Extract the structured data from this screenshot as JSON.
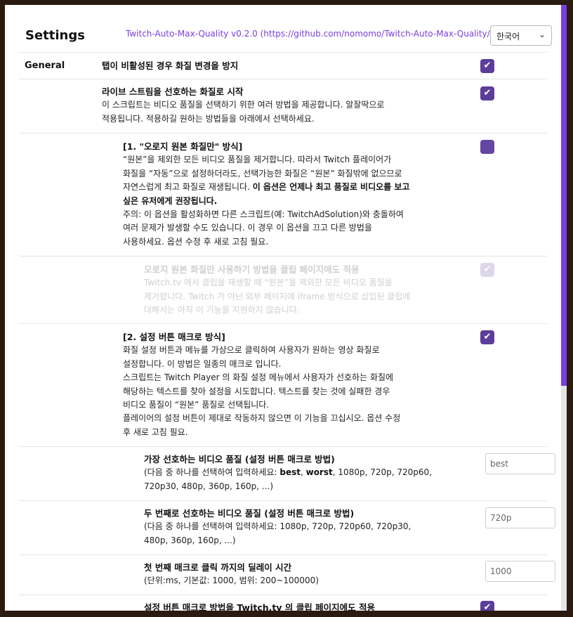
{
  "header": {
    "title": "Settings",
    "repo_link": "Twitch-Auto-Max-Quality v0.2.0 (https://github.com/nomomo/Twitch-Auto-Max-Quality/)",
    "language": "한국어"
  },
  "section_label": "General",
  "rows": {
    "r1": {
      "title": "탭이 비활성된 경우 화질 변경을 방지",
      "checked": true
    },
    "r2": {
      "title": "라이브 스트림을 선호하는 화질로 시작",
      "desc1": "이 스크립트는 비디오 품질을 선택하기 위한 여러 방법을 제공합니다. 알잘딱으로",
      "desc2": "적용됩니다. 적용하길 원하는 방법들을 아래에서 선택하세요.",
      "checked": true
    },
    "r3": {
      "title": "[1. \"오로지 원본 화질만\" 방식]",
      "l1": "“원본”을 제외한 모든 비디오 품질을 제거합니다. 따라서 Twitch 플레이어가",
      "l2": "화질을 “자동”으로 설정하더라도, 선택가능한 화질은 “원본” 화질밖에 없으므로",
      "l3a": "자연스럽게 최고 화질로 재생됩니다. ",
      "l3b": "이 옵션은 언제나 최고 품질로 비디오를 보고",
      "l4": "싶은 유저에게 권장됩니다.",
      "l5": "주의: 이 옵션을 활성화하면 다른 스크립트(예: TwitchAdSolution)와 충돌하여",
      "l6": "여러 문제가 발생할 수도 있습니다. 이 경우 이 옵션을 끄고 다른 방법을",
      "l7": "사용하세요. 옵션 수정 후 새로 고침 필요.",
      "checked": true
    },
    "r4": {
      "title": "오로지 원본 화질만 사용하기 방법을 클립 페이지에도 적용",
      "l1": "Twitch.tv 에서 클립을 재생할 때 “원본”을 제외한 모든 비디오 품질을",
      "l2": "제거합니다. Twitch 가 아닌 외부 페이지에 iframe 방식으로 삽입된 클립에",
      "l3": "대해서는 아직 이 기능을 지원하지 않습니다.",
      "checked": true,
      "disabled": true
    },
    "r5": {
      "title": "[2. 설정 버튼 매크로 방식]",
      "l1": "화질 설정 버튼과 메뉴를 가상으로 클릭하여 사용자가 원하는 영상 화질로",
      "l2": "설정합니다. 이 방법은 일종의 매크로 입니다.",
      "l3": "스크립트는 Twitch Player 의 화질 설정 메뉴에서 사용자가 선호하는 화질에",
      "l4": "해당하는 텍스트를 찾아 설정을 시도합니다. 텍스트를 찾는 것에 실패한 경우",
      "l5": "비디오 품질이 “원본” 품질로 선택됩니다.",
      "l6": "플레이어의 설정 버튼이 제대로 작동하지 않으면 이 기능을 끄십시오. 옵션 수정",
      "l7": "후 새로 고침 필요.",
      "checked": true
    },
    "r6": {
      "title": "가장 선호하는 비디오 품질 (설정 버튼 매크로 방법)",
      "l1a": "(다음 중 하나를 선택하여 입력하세요: ",
      "l1b": "best",
      "l1c": ", ",
      "l1d": "worst",
      "l1e": ", 1080p, 720p, 720p60,",
      "l2": "720p30, 480p, 360p, 160p, ...)",
      "value": "best"
    },
    "r7": {
      "title": "두 번째로 선호하는 비디오 품질 (설정 버튼 매크로 방법)",
      "l1": "(다음 중 하나를 선택하여 입력하세요: 1080p, 720p, 720p60, 720p30,",
      "l2": "480p, 360p, 160p, ...)",
      "value": "720p"
    },
    "r8": {
      "title": "첫 번째 매크로 클릭 까지의 딜레이 시간",
      "l1": "(단위:ms, 기본값: 1000, 범위: 200~100000)",
      "value": "1000"
    },
    "r9": {
      "title": "설정 버튼 매크로 방법을 Twitch.tv 의 클립 페이지에도 적용",
      "checked": true
    }
  },
  "colors": {
    "accent": "#7b3ee0",
    "checkbox": "#5c3d99"
  },
  "icons": {
    "checkmark": "check-icon",
    "dropdown": "chevron-down-icon"
  }
}
